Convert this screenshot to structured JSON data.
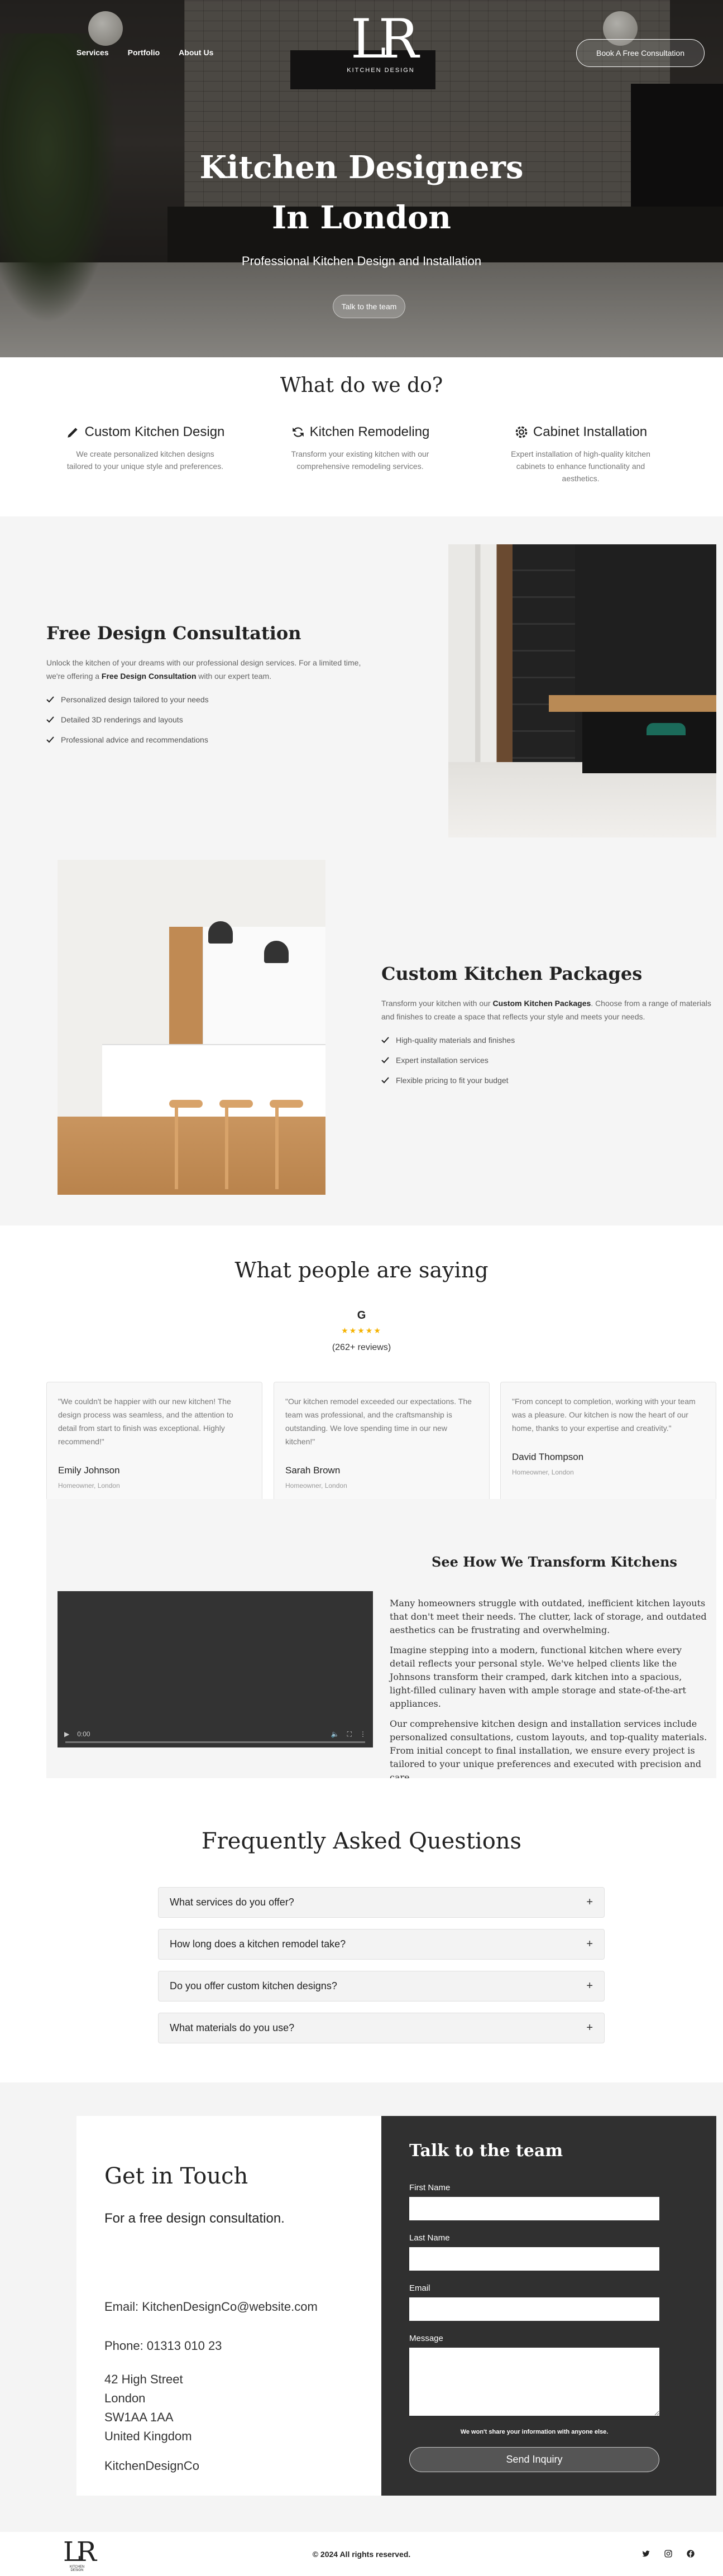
{
  "header": {
    "nav": [
      "Services",
      "Portfolio",
      "About Us"
    ],
    "logo_mark": "LR",
    "logo_sub": "KITCHEN DESIGN",
    "cta": "Book A Free Consultation"
  },
  "hero": {
    "title": "Kitchen Designers In London",
    "tagline": "Professional Kitchen Design and Installation",
    "button": "Talk to the team"
  },
  "services": {
    "heading": "What do we do?",
    "items": [
      {
        "icon": "pencil-icon",
        "title": "Custom Kitchen Design",
        "desc": "We create personalized kitchen designs tailored to your unique style and preferences."
      },
      {
        "icon": "sync-icon",
        "title": "Kitchen Remodeling",
        "desc": "Transform your existing kitchen with our comprehensive remodeling services."
      },
      {
        "icon": "gear-icon",
        "title": "Cabinet Installation",
        "desc": "Expert installation of high-quality kitchen cabinets to enhance functionality and aesthetics."
      }
    ]
  },
  "features": [
    {
      "title": "Free Design Consultation",
      "text_before": "Unlock the kitchen of your dreams with our professional design services. For a limited time, we're offering a ",
      "text_bold": "Free Design Consultation",
      "text_after": " with our expert team.",
      "bullets": [
        "Personalized design tailored to your needs",
        "Detailed 3D renderings and layouts",
        "Professional advice and recommendations"
      ]
    },
    {
      "title": "Custom Kitchen Packages",
      "text_before": "Transform your kitchen with our ",
      "text_bold": "Custom Kitchen Packages",
      "text_after": ". Choose from a range of materials and finishes to create a space that reflects your style and meets your needs.",
      "bullets": [
        "High-quality materials and finishes",
        "Expert installation services",
        "Flexible pricing to fit your budget"
      ]
    }
  ],
  "testimonials": {
    "heading": "What people are saying",
    "google": "G",
    "stars": "★★★★★",
    "reviews": "(262+ reviews)",
    "items": [
      {
        "quote": "\"We couldn't be happier with our new kitchen! The design process was seamless, and the attention to detail from start to finish was exceptional. Highly recommend!\"",
        "name": "Emily Johnson",
        "role": "Homeowner, London"
      },
      {
        "quote": "\"Our kitchen remodel exceeded our expectations. The team was professional, and the craftsmanship is outstanding. We love spending time in our new kitchen!\"",
        "name": "Sarah Brown",
        "role": "Homeowner, London"
      },
      {
        "quote": "\"From concept to completion, working with your team was a pleasure. Our kitchen is now the heart of our home, thanks to your expertise and creativity.\"",
        "name": "David Thompson",
        "role": "Homeowner, London"
      }
    ]
  },
  "video": {
    "heading": "See How We Transform Kitchens",
    "time": "0:00",
    "paragraphs": [
      "Many homeowners struggle with outdated, inefficient kitchen layouts that don't meet their needs. The clutter, lack of storage, and outdated aesthetics can be frustrating and overwhelming.",
      "Imagine stepping into a modern, functional kitchen where every detail reflects your personal style. We've helped clients like the Johnsons transform their cramped, dark kitchen into a spacious, light-filled culinary haven with ample storage and state-of-the-art appliances.",
      "Our comprehensive kitchen design and installation services include personalized consultations, custom layouts, and top-quality materials. From initial concept to final installation, we ensure every project is tailored to your unique preferences and executed with precision and care."
    ]
  },
  "faq": {
    "heading": "Frequently Asked Questions",
    "items": [
      "What services do you offer?",
      "How long does a kitchen remodel take?",
      "Do you offer custom kitchen designs?",
      "What materials do you use?"
    ],
    "toggle": "+"
  },
  "contact": {
    "heading": "Get in Touch",
    "subheading": "For a free design consultation.",
    "email": "Email: KitchenDesignCo@website.com",
    "phone": "Phone: 01313 010 23",
    "address": [
      "42 High Street",
      "London",
      "SW1AA 1AA",
      "United Kingdom"
    ],
    "company": "KitchenDesignCo",
    "form": {
      "title": "Talk to the team",
      "first_name": "First Name",
      "last_name": "Last Name",
      "email": "Email",
      "message": "Message",
      "note": "We won't share your information with anyone else.",
      "submit": "Send Inquiry"
    }
  },
  "footer": {
    "logo_mark": "LR",
    "logo_sub": "KITCHEN DESIGN",
    "copyright": "© 2024 All rights reserved.",
    "social": [
      "twitter-icon",
      "instagram-icon",
      "facebook-icon"
    ]
  }
}
